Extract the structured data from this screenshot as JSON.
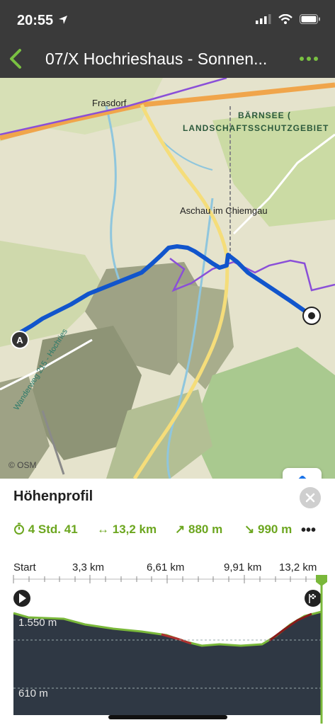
{
  "status": {
    "time": "20:55"
  },
  "nav": {
    "title": "07/X Hochrieshaus - Sonnen..."
  },
  "map": {
    "labels": {
      "frasdorf": "Frasdorf",
      "barnsee_1": "BÄRNSEE (",
      "barnsee_2": "LANDSCHAFTSSCHUTZGEBIET",
      "aschau": "Aschau im Chiemgau",
      "wanderweg": "Wanderweg 215 - Hochries"
    },
    "start_marker": "A",
    "attribution": "© OSM",
    "controls": [
      "hiker-icon",
      "locate-arrow-icon"
    ]
  },
  "panel": {
    "title": "Höhenprofil",
    "stats": {
      "duration": "4 Std. 41",
      "distance": "13,2 km",
      "ascent": "880 m",
      "descent": "990 m"
    },
    "distance_axis": [
      "Start",
      "3,3 km",
      "6,61 km",
      "9,91 km",
      "13,2 km"
    ],
    "elevation_labels": [
      "1.550 m",
      "610 m"
    ]
  },
  "colors": {
    "accent_green": "#6ca61f",
    "route_blue": "#1155cc",
    "profile_fill": "#2f3844",
    "border_purple": "#8a4fd8"
  }
}
